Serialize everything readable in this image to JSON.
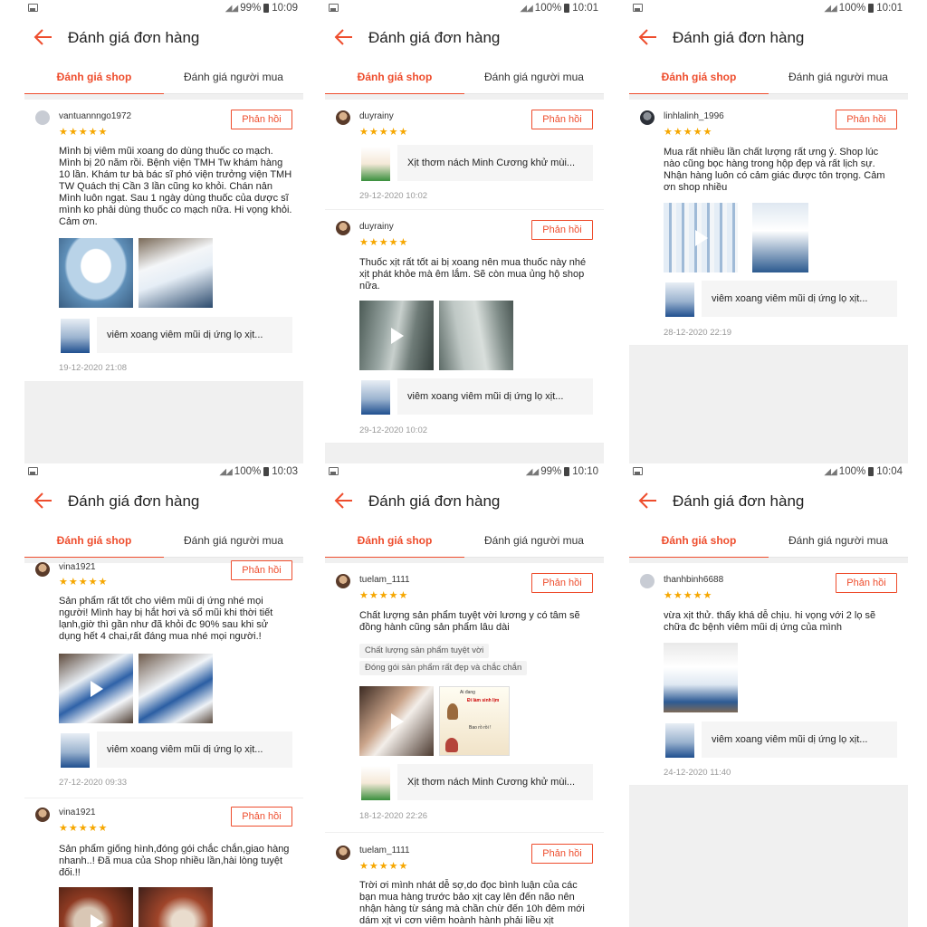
{
  "screen": {
    "title": "Đánh giá đơn hàng",
    "tabs": [
      "Đánh giá shop",
      "Đánh giá người mua"
    ],
    "reply_label": "Phản hồi",
    "stars": "★★★★★"
  },
  "products": {
    "sinus": "viêm xoang viêm mũi dị ứng lọ xịt...",
    "minh": "Xịt thơm nách Minh Cương khử mùi..."
  },
  "panels": [
    {
      "status": {
        "battery": "99%",
        "time": "10:09"
      },
      "reviews": [
        {
          "username": "vantuannngo1972",
          "text": " Mình bị viêm mũi xoang do dùng thuốc co mạch. Mình bị 20 năm rồi. Bệnh viện TMH Tw khám hàng 10 lần. Khám tư bà bác sĩ phó viện trưởng viện TMH TW Quách thị Cần 3 lần cũng ko khỏi. Chán nản Mình luôn ngạt. Sau 1 ngày dùng thuốc của dược sĩ mình ko phải dùng thuốc co mạch nữa. Hi vọng khỏi. Cảm ơn.",
          "date": "19-12-2020 21:08"
        }
      ]
    },
    {
      "status": {
        "battery": "100%",
        "time": "10:01"
      },
      "reviews": [
        {
          "username": "duyrainy",
          "date": "29-12-2020 10:02"
        },
        {
          "username": "duyrainy",
          "text": "Thuốc xịt rất tốt ai bị xoang nên mua thuốc này nhé xịt phát khỏe mà êm lắm. Sẽ còn mua ủng hộ shop nữa.",
          "date": "29-12-2020 10:02"
        }
      ]
    },
    {
      "status": {
        "battery": "100%",
        "time": "10:01"
      },
      "reviews": [
        {
          "username": "linhlalinh_1996",
          "text": "Mua rất nhiều lần chất lượng rất ưng ý. Shop lúc nào cũng bọc hàng trong hộp đẹp và rất lịch sự. Nhận hàng luôn có  cảm giác được tôn trọng. Cảm ơn shop nhiều",
          "date": "28-12-2020 22:19"
        }
      ]
    },
    {
      "status": {
        "battery": "100%",
        "time": "10:03"
      },
      "reviews": [
        {
          "username": "vina1921",
          "text": "Sản phẩm rất tốt cho viêm mũi dị ứng nhé mọi người! Mình hay bị hắt hơi và sổ mũi khi thời tiết lạnh,giờ thì gần như đã khỏi đc 90% sau khi sử dụng hết 4 chai,rất đáng mua nhé mọi người.!",
          "date": "27-12-2020 09:33"
        },
        {
          "username": "vina1921",
          "text": "Sản phẩm giống hình,đóng gói chắc chắn,giao hàng nhanh..! Đã mua của Shop nhiều lần,hài lòng tuyệt đối.!!"
        }
      ]
    },
    {
      "status": {
        "battery": "99%",
        "time": "10:10"
      },
      "reviews": [
        {
          "username": "tuelam_1111",
          "text": "Chất lượng sản phẩm tuyệt vời lương y có tâm sẽ đồng hành cũng sản phẩm lâu dài",
          "tags": [
            "Chất lượng sản phẩm tuyệt vời",
            "Đóng gói sản phẩm rất đẹp và chắc chắn"
          ],
          "comic_text": [
            "Ai đang",
            "Đi làm sinh lịm",
            "Bao rồ rồi !"
          ],
          "date": "18-12-2020 22:26"
        },
        {
          "username": "tuelam_1111",
          "text": "Trời ơi mình nhát dễ sợ,do đọc bình luận của các bạn mua hàng trước bảo xịt cay lên đến não nên nhận hàng từ sáng mà chần chừ đến 10h đêm mới dám xịt vì cơn viêm hoành hành phải liều xịt"
        }
      ]
    },
    {
      "status": {
        "battery": "100%",
        "time": "10:04"
      },
      "reviews": [
        {
          "username": "thanhbinh6688",
          "text": "vừa xịt thử.  thấy khá dễ chịu. hi vọng với 2 lọ sẽ chữa đc bệnh viêm mũi dị ứng của mình",
          "date": "24-12-2020 11:40"
        }
      ]
    }
  ]
}
